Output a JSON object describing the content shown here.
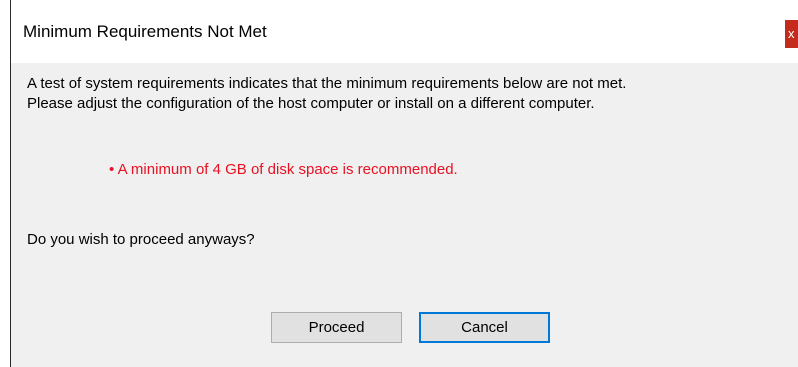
{
  "window": {
    "title": "Minimum Requirements Not Met",
    "close_label": "x"
  },
  "message": {
    "line1": "A test of system requirements indicates that the minimum requirements below are not met.",
    "line2": "Please adjust the configuration of the host computer or install on a different computer."
  },
  "requirements": [
    "• A minimum of 4 GB of disk space is recommended."
  ],
  "question": "Do you wish to proceed anyways?",
  "buttons": {
    "proceed": "Proceed",
    "cancel": "Cancel"
  },
  "colors": {
    "warning_text": "#e81123",
    "close_button": "#c42b1c",
    "focus_border": "#0078d7"
  }
}
